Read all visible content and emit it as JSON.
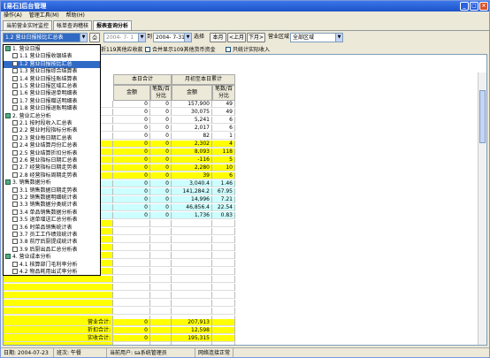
{
  "window": {
    "title": "[易石]后台管理"
  },
  "menu": [
    "操作(A)",
    "管理工具(M)",
    "帮助(H)"
  ],
  "tabs": [
    {
      "label": "当前营业实时监控"
    },
    {
      "label": "帐单查询稽核"
    },
    {
      "label": "报表查询分析"
    }
  ],
  "toolbar": {
    "report_select": "1.2 营业日报按比汇总表",
    "date_from": "2004- 7- 1",
    "to_label": "到",
    "date_to": "2004- 7-31",
    "select_label": "选择",
    "this_month": "本月",
    "prev_month": "<上月",
    "next_month": "下月>",
    "area_label": "营业区域",
    "area_value": "全部区域"
  },
  "options": [
    {
      "label": "折119其他应收款"
    },
    {
      "label": "合并显示109其他货币资金"
    },
    {
      "label": "只统计实际收入"
    }
  ],
  "headers": {
    "current": "本日合计",
    "monthly": "月初至本日累计",
    "amount": "金额",
    "percent": "笔数/百分比",
    "amount2": "金额",
    "percent2": "笔数/百分比"
  },
  "rows": [
    {
      "a": "0",
      "b": "0",
      "c": "157,900",
      "d": "49",
      "bg": "#ffffff"
    },
    {
      "a": "0",
      "b": "0",
      "c": "30,075",
      "d": "49",
      "bg": "#ffffff"
    },
    {
      "a": "0",
      "b": "0",
      "c": "5,241",
      "d": "6",
      "bg": "#ffffff"
    },
    {
      "a": "0",
      "b": "0",
      "c": "2,017",
      "d": "6",
      "bg": "#ffffff"
    },
    {
      "a": "0",
      "b": "0",
      "c": "82",
      "d": "1",
      "bg": "#ffffff"
    },
    {
      "a": "0",
      "b": "0",
      "c": "2,302",
      "d": "4",
      "bg": "#ffff00"
    },
    {
      "a": "0",
      "b": "0",
      "c": "8,093",
      "d": "118",
      "bg": "#ffff00"
    },
    {
      "a": "0",
      "b": "0",
      "c": "-116",
      "d": "5",
      "bg": "#ffff00"
    },
    {
      "a": "0",
      "b": "0",
      "c": "2,280",
      "d": "10",
      "bg": "#ffff00"
    },
    {
      "a": "0",
      "b": "0",
      "c": "39",
      "d": "6",
      "bg": "#ffff00"
    },
    {
      "a": "0",
      "b": "0",
      "c": "3,040.4",
      "d": "1.46",
      "bg": "#ccffff"
    },
    {
      "a": "0",
      "b": "0",
      "c": "141,284.2",
      "d": "67.95",
      "bg": "#ccffff"
    },
    {
      "a": "0",
      "b": "0",
      "c": "14,996",
      "d": "7.21",
      "bg": "#ccffff"
    },
    {
      "a": "0",
      "b": "0",
      "c": "46,856.4",
      "d": "22.54",
      "bg": "#ccffff"
    },
    {
      "a": "0",
      "b": "0",
      "c": "1,736",
      "d": "0.83",
      "bg": "#ccffff"
    }
  ],
  "totals": [
    {
      "label": "营业合计:",
      "a": "0",
      "c": "207,913"
    },
    {
      "label": "折扣合计:",
      "a": "0",
      "c": "12,598"
    },
    {
      "label": "实收合计:",
      "a": "0",
      "c": "195,315"
    }
  ],
  "dropdown": [
    {
      "label": "1. 营业日报",
      "grp": true
    },
    {
      "label": "1.1 营业日报收银结表",
      "grp": false
    },
    {
      "label": "1.2 营业日报按比汇总",
      "grp": false,
      "sel": true
    },
    {
      "label": "1.3 营业日报综合结算表",
      "grp": false
    },
    {
      "label": "1.4 营业日报挂账结算表",
      "grp": false
    },
    {
      "label": "1.5 营业日报区域汇总表",
      "grp": false
    },
    {
      "label": "1.6 营业日报退单明细表",
      "grp": false
    },
    {
      "label": "1.7 营业日报赠送明细表",
      "grp": false
    },
    {
      "label": "1.8 营业日报退账明细表",
      "grp": false
    },
    {
      "label": "2. 营业汇总分析",
      "grp": true
    },
    {
      "label": "2.1 按时段收入汇总表",
      "grp": false
    },
    {
      "label": "2.2 营业时段指标分析表",
      "grp": false
    },
    {
      "label": "2.3 营业每日期汇总表",
      "grp": false
    },
    {
      "label": "2.4 营业结算月份汇总表",
      "grp": false
    },
    {
      "label": "2.5 营业结算折扣分析表",
      "grp": false
    },
    {
      "label": "2.6 营业指标日期汇总表",
      "grp": false
    },
    {
      "label": "2.7 经营指标日期走势表",
      "grp": false
    },
    {
      "label": "2.8 经营指标周期走势表",
      "grp": false
    },
    {
      "label": "3. 销售数据分析",
      "grp": true
    },
    {
      "label": "3.1 销售数据日期走势表",
      "grp": false
    },
    {
      "label": "3.2 销售数据明细统计表",
      "grp": false
    },
    {
      "label": "3.3 销售数据分类统计表",
      "grp": false
    },
    {
      "label": "3.4 单品销售数据分析表",
      "grp": false
    },
    {
      "label": "3.5 退单增送汇总分析表",
      "grp": false
    },
    {
      "label": "3.6 时菜品销售统计表",
      "grp": false
    },
    {
      "label": "3.7 员工工作绩效统计表",
      "grp": false
    },
    {
      "label": "3.8 前厅后厨提成统计表",
      "grp": false
    },
    {
      "label": "3.9 后厨出品汇总分析表",
      "grp": false
    },
    {
      "label": "4. 营业成本分析",
      "grp": true
    },
    {
      "label": "4.1 核算部门毛利率分析",
      "grp": false
    },
    {
      "label": "4.2 物品耗用出式率分析",
      "grp": false
    }
  ],
  "status": [
    {
      "label": "日期: 2004-07-23"
    },
    {
      "label": "班次: 午餐"
    },
    {
      "label": "当前用户: sa系统管理员"
    },
    {
      "label": "网络连接正常"
    }
  ]
}
